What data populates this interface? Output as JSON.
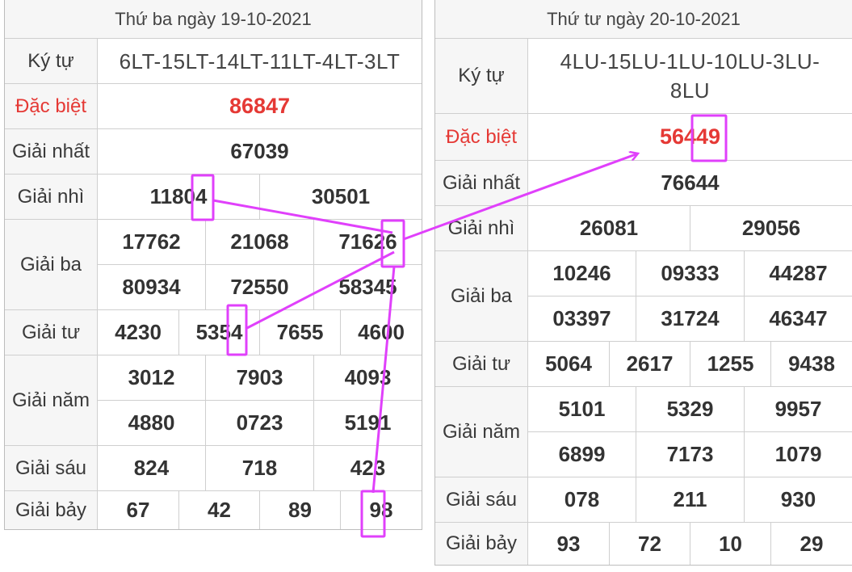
{
  "left": {
    "date": "Thứ ba ngày 19-10-2021",
    "labels": {
      "kytu": "Ký tự",
      "db": "Đặc biệt",
      "g1": "Giải nhất",
      "g2": "Giải nhì",
      "g3": "Giải ba",
      "g4": "Giải tư",
      "g5": "Giải năm",
      "g6": "Giải sáu",
      "g7": "Giải bảy"
    },
    "kytu": "6LT-15LT-14LT-11LT-4LT-3LT",
    "db": "86847",
    "g1": "67039",
    "g2": [
      "11804",
      "30501"
    ],
    "g3": [
      "17762",
      "21068",
      "71626",
      "80934",
      "72550",
      "58345"
    ],
    "g4": [
      "4230",
      "5354",
      "7655",
      "4600"
    ],
    "g5": [
      "3012",
      "7903",
      "4093",
      "4880",
      "0723",
      "5191"
    ],
    "g6": [
      "824",
      "718",
      "423"
    ],
    "g7": [
      "67",
      "42",
      "89",
      "98"
    ]
  },
  "right": {
    "date": "Thứ tư ngày 20-10-2021",
    "labels": {
      "kytu": "Ký tự",
      "db": "Đặc biệt",
      "g1": "Giải nhất",
      "g2": "Giải nhì",
      "g3": "Giải ba",
      "g4": "Giải tư",
      "g5": "Giải năm",
      "g6": "Giải sáu",
      "g7": "Giải bảy"
    },
    "kytu_line1": "4LU-15LU-1LU-10LU-3LU-",
    "kytu_line2": "8LU",
    "db": "56449",
    "g1": "76644",
    "g2": [
      "26081",
      "29056"
    ],
    "g3": [
      "10246",
      "09333",
      "44287",
      "03397",
      "31724",
      "46347"
    ],
    "g4": [
      "5064",
      "2617",
      "1255",
      "9438"
    ],
    "g5": [
      "5101",
      "5329",
      "9957",
      "6899",
      "7173",
      "1079"
    ],
    "g6": [
      "078",
      "211",
      "930"
    ],
    "g7": [
      "93",
      "72",
      "10",
      "29"
    ]
  },
  "annotation": {
    "color": "#e040fb"
  }
}
